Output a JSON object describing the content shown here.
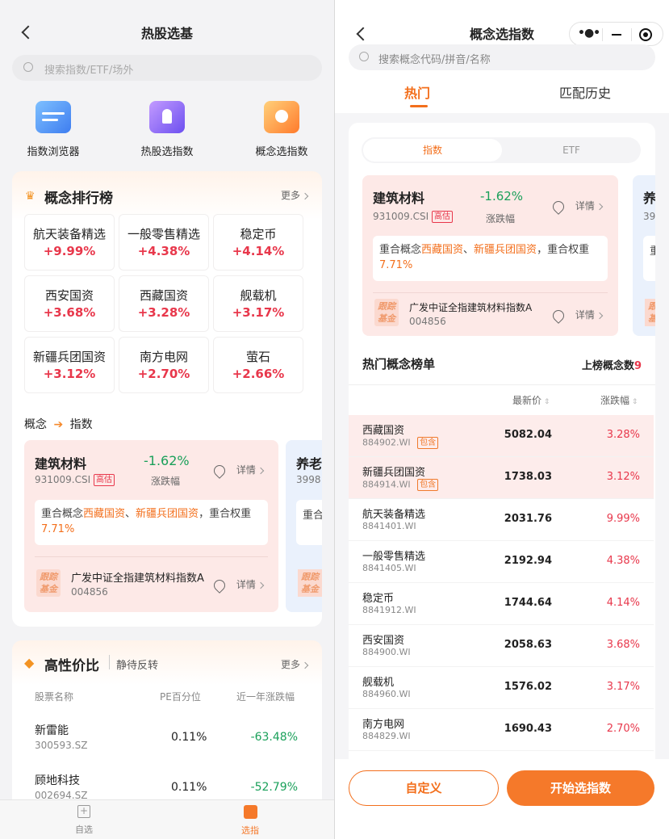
{
  "left": {
    "title": "热股选基",
    "search_placeholder": "搜索指数/ETF/场外",
    "quick": [
      {
        "label": "指数浏览器",
        "icon": "list-window-icon"
      },
      {
        "label": "热股选指数",
        "icon": "rocket-icon"
      },
      {
        "label": "概念选指数",
        "icon": "pie-chart-icon"
      }
    ],
    "ranking": {
      "title": "概念排行榜",
      "more": "更多",
      "items": [
        {
          "name": "航天装备精选",
          "pct": "+9.99%"
        },
        {
          "name": "一般零售精选",
          "pct": "+4.38%"
        },
        {
          "name": "稳定币",
          "pct": "+4.14%"
        },
        {
          "name": "西安国资",
          "pct": "+3.68%"
        },
        {
          "name": "西藏国资",
          "pct": "+3.28%"
        },
        {
          "name": "舰载机",
          "pct": "+3.17%"
        },
        {
          "name": "新疆兵团国资",
          "pct": "+3.12%"
        },
        {
          "name": "南方电网",
          "pct": "+2.70%"
        },
        {
          "name": "萤石",
          "pct": "+2.66%"
        }
      ]
    },
    "concept_to_index": {
      "label_a": "概念",
      "label_b": "指数"
    },
    "index_card": {
      "name": "建筑材料",
      "code": "931009.CSI",
      "tag": "高估",
      "change": "-1.62%",
      "change_label": "涨跌幅",
      "detail": "详情",
      "overlap_prefix": "重合概念",
      "overlap_a": "西藏国资",
      "overlap_sep": "、",
      "overlap_b": "新疆兵团国资",
      "overlap_mid": "，重合权重",
      "overlap_weight": "7.71%",
      "fund_badge": "跟踪基金",
      "fund_name": "广发中证全指建筑材料指数A",
      "fund_code": "004856",
      "fund_detail": "详情"
    },
    "peek_card": {
      "name": "养老",
      "code": "3998",
      "overlap": "重合",
      "badge": "跟踪基金"
    },
    "value": {
      "title": "高性价比",
      "subtitle": "静待反转",
      "more": "更多",
      "headers": [
        "股票名称",
        "PE百分位",
        "近一年涨跌幅"
      ],
      "rows": [
        {
          "name": "新雷能",
          "code": "300593.SZ",
          "pe": "0.11%",
          "chg": "-63.48%"
        },
        {
          "name": "顾地科技",
          "code": "002694.SZ",
          "pe": "0.11%",
          "chg": "-52.79%"
        }
      ]
    },
    "tabbar": [
      {
        "label": "自选",
        "icon": "add-watchlist-icon"
      },
      {
        "label": "选指",
        "icon": "chart-select-icon"
      }
    ]
  },
  "right": {
    "title": "概念选指数",
    "search_placeholder": "搜索概念代码/拼音/名称",
    "tabs": [
      "热门",
      "匹配历史"
    ],
    "seg": [
      "指数",
      "ETF"
    ],
    "card": {
      "name": "建筑材料",
      "code": "931009.CSI",
      "tag": "高估",
      "change": "-1.62%",
      "change_label": "涨跌幅",
      "detail": "详情",
      "overlap_prefix": "重合概念",
      "overlap_a": "西藏国资",
      "overlap_sep": "、",
      "overlap_b": "新疆兵团国资",
      "overlap_mid": "，重合权重",
      "overlap_weight": "7.71%",
      "fund_badge": "跟踪基金",
      "fund_name": "广发中证全指建筑材料指数A",
      "fund_code": "004856",
      "fund_detail": "详情"
    },
    "peek": {
      "name": "养",
      "code": "39",
      "overlap": "重",
      "badge": "跟踪基金"
    },
    "list": {
      "title": "热门概念榜单",
      "count_label": "上榜概念数",
      "count": "9",
      "col_price": "最新价",
      "col_change": "涨跌幅",
      "contains": "包含",
      "rows": [
        {
          "name": "西藏国资",
          "code": "884902.WI",
          "price": "5082.04",
          "chg": "3.28%",
          "contains": true
        },
        {
          "name": "新疆兵团国资",
          "code": "884914.WI",
          "price": "1738.03",
          "chg": "3.12%",
          "contains": true
        },
        {
          "name": "航天装备精选",
          "code": "8841401.WI",
          "price": "2031.76",
          "chg": "9.99%",
          "contains": false
        },
        {
          "name": "一般零售精选",
          "code": "8841405.WI",
          "price": "2192.94",
          "chg": "4.38%",
          "contains": false
        },
        {
          "name": "稳定币",
          "code": "8841912.WI",
          "price": "1744.64",
          "chg": "4.14%",
          "contains": false
        },
        {
          "name": "西安国资",
          "code": "884900.WI",
          "price": "2058.63",
          "chg": "3.68%",
          "contains": false
        },
        {
          "name": "舰载机",
          "code": "884960.WI",
          "price": "1576.02",
          "chg": "3.17%",
          "contains": false
        },
        {
          "name": "南方电网",
          "code": "884829.WI",
          "price": "1690.43",
          "chg": "2.70%",
          "contains": false
        }
      ]
    },
    "btn_custom": "自定义",
    "btn_start": "开始选指数"
  }
}
